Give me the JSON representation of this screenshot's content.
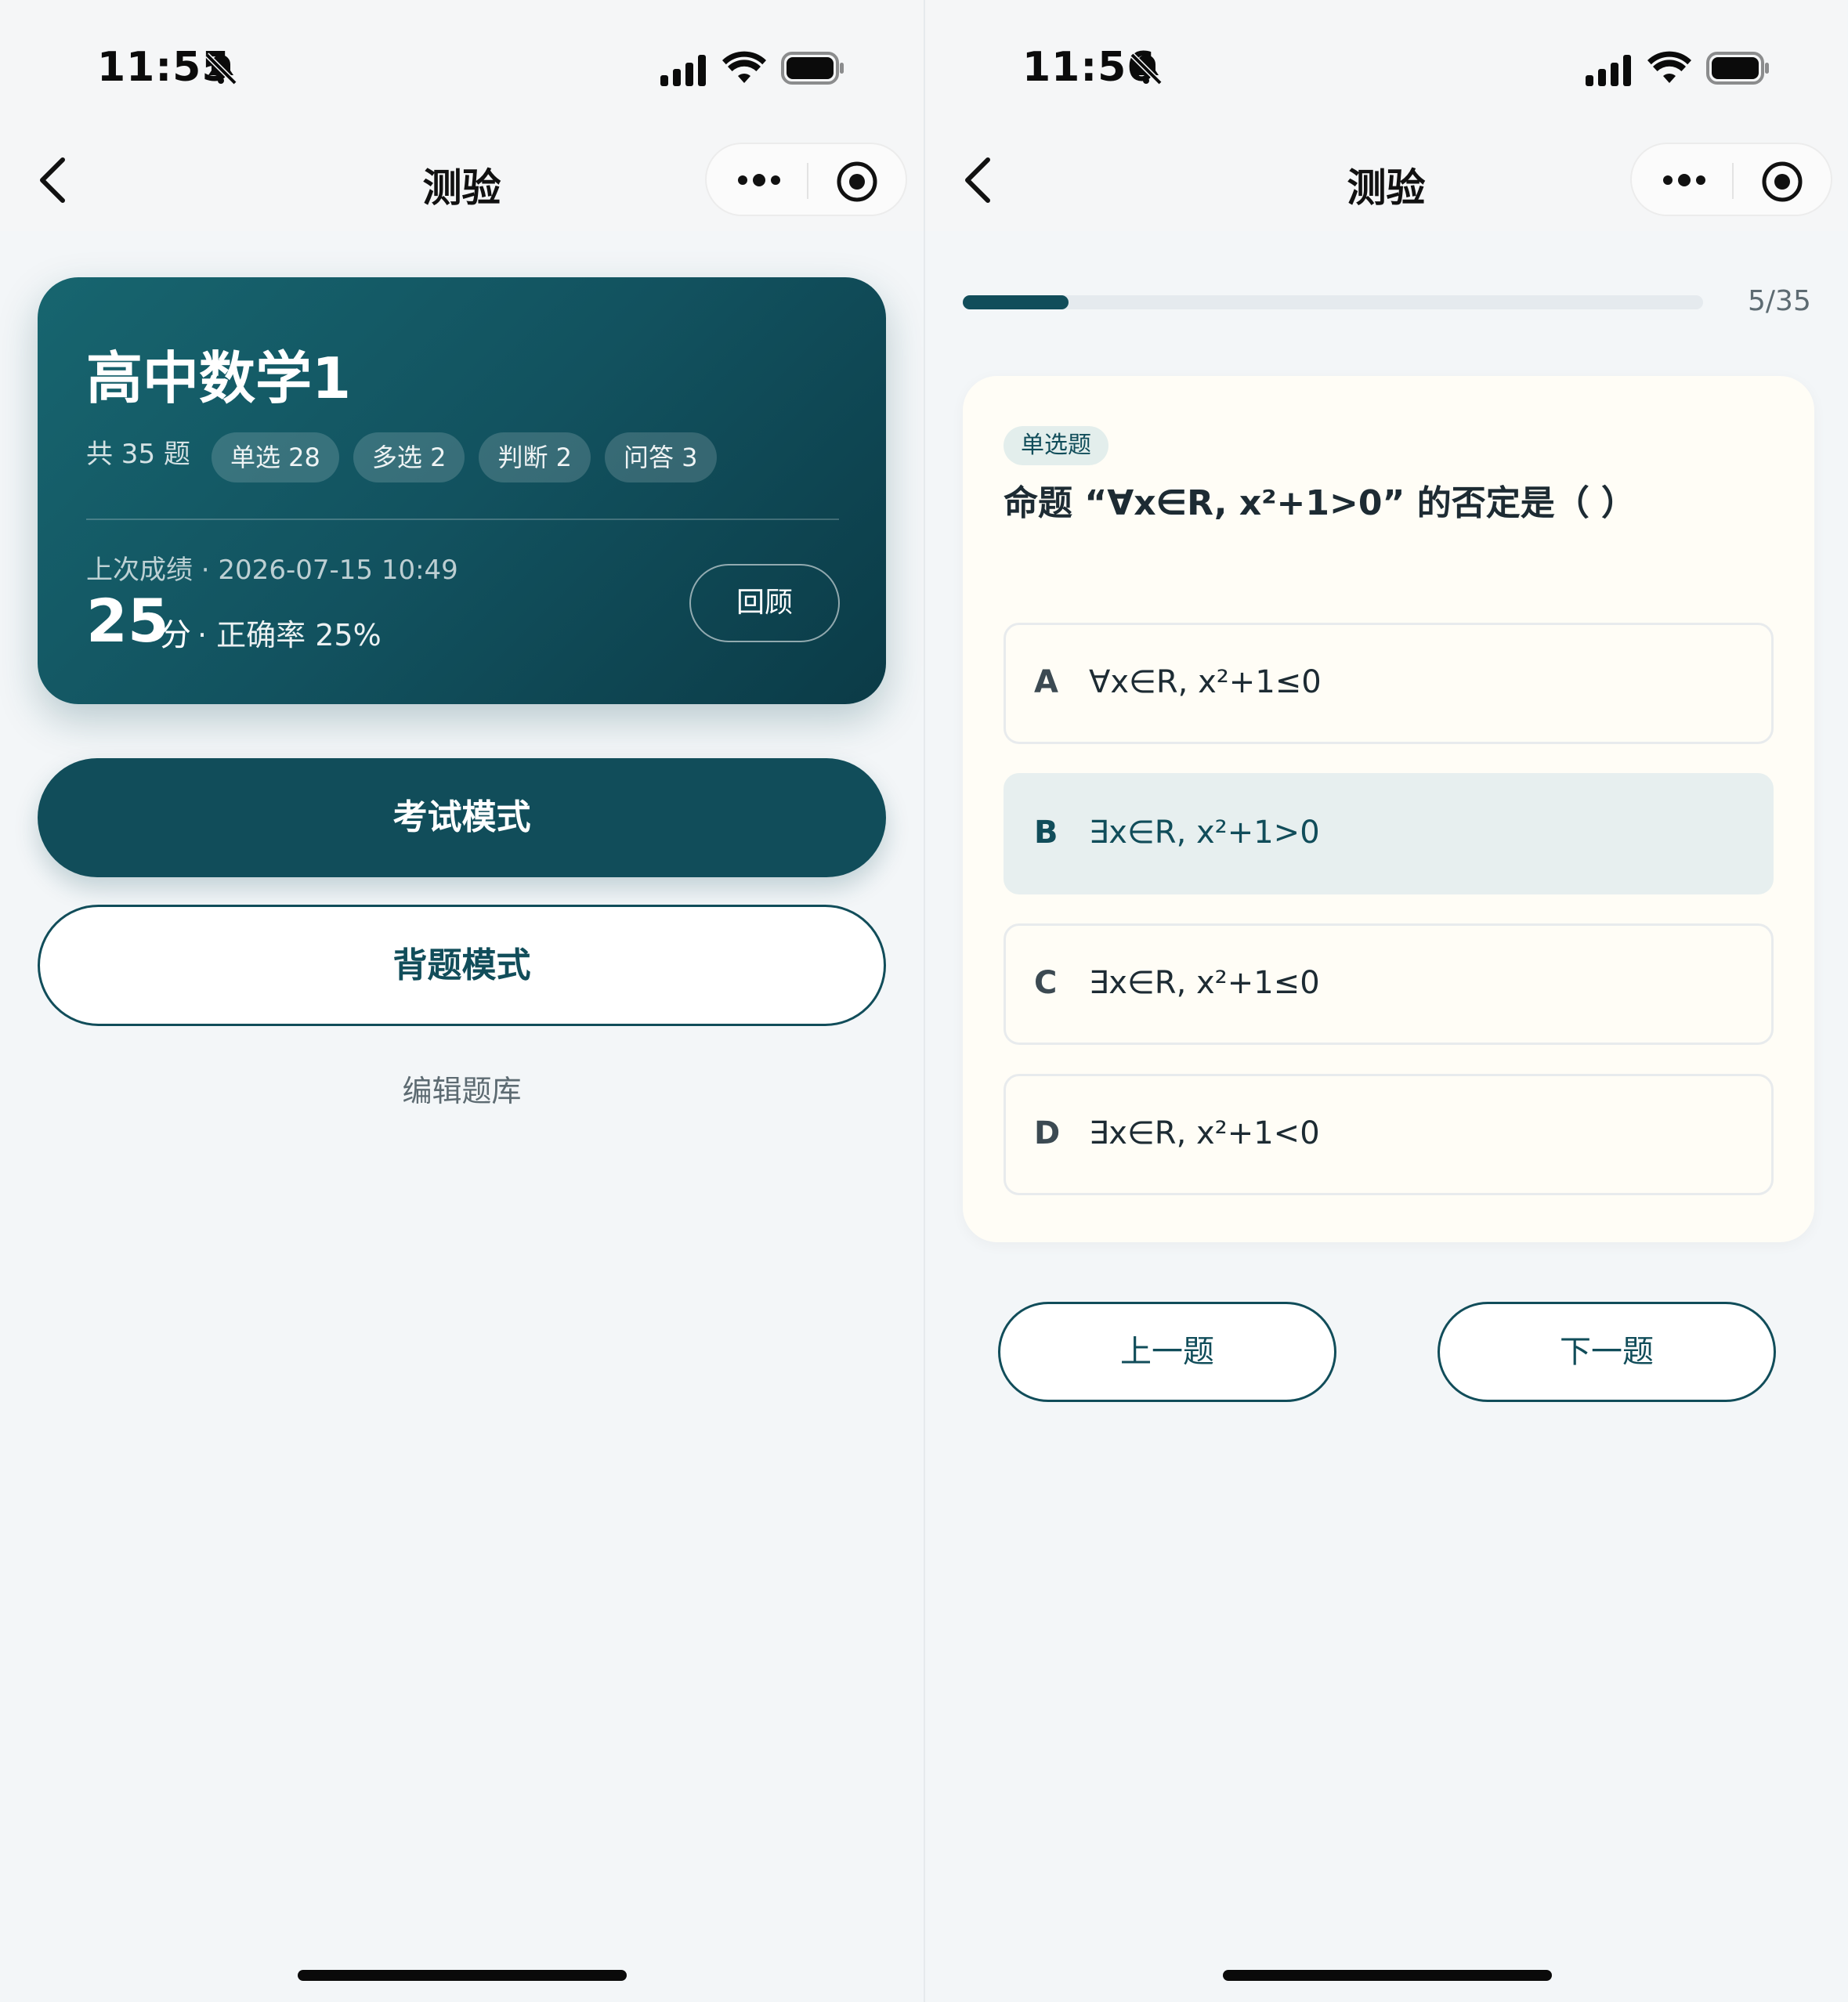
{
  "left": {
    "status": {
      "time": "11:55"
    },
    "nav": {
      "title": "测验"
    },
    "hero": {
      "title": "高中数学1",
      "total": "共 35 题",
      "chips": [
        "单选 28",
        "多选 2",
        "判断 2",
        "问答 3"
      ],
      "last_label": "上次成绩 · 2026-07-15 10:49",
      "score": "25",
      "score_unit": "分",
      "accuracy": "· 正确率 25%",
      "review_label": "回顾"
    },
    "exam_mode_label": "考试模式",
    "memorize_mode_label": "背题模式",
    "edit_label": "编辑题库"
  },
  "right": {
    "status": {
      "time": "11:56"
    },
    "nav": {
      "title": "测验"
    },
    "progress": {
      "text": "5/35",
      "current": 5,
      "total": 35
    },
    "question": {
      "type": "单选题",
      "text": "命题 “∀x∈R, x²+1>0” 的否定是（ ）",
      "options": [
        {
          "letter": "A",
          "text": "∀x∈R, x²+1≤0"
        },
        {
          "letter": "B",
          "text": "∃x∈R, x²+1>0",
          "selected": true
        },
        {
          "letter": "C",
          "text": "∃x∈R, x²+1≤0"
        },
        {
          "letter": "D",
          "text": "∃x∈R, x²+1<0"
        }
      ]
    },
    "prev_label": "上一题",
    "next_label": "下一题"
  },
  "icons": {
    "back": "chevron-left-icon",
    "more": "more-dots-icon",
    "close": "target-circle-icon",
    "mute": "bell-slash-icon",
    "signal": "signal-icon",
    "wifi": "wifi-icon",
    "battery": "battery-icon"
  },
  "colors": {
    "primary": "#114d5a",
    "hero_start": "#17656f",
    "hero_end": "#0b3b47",
    "background": "#f3f6f8",
    "card": "#fffdf6"
  }
}
